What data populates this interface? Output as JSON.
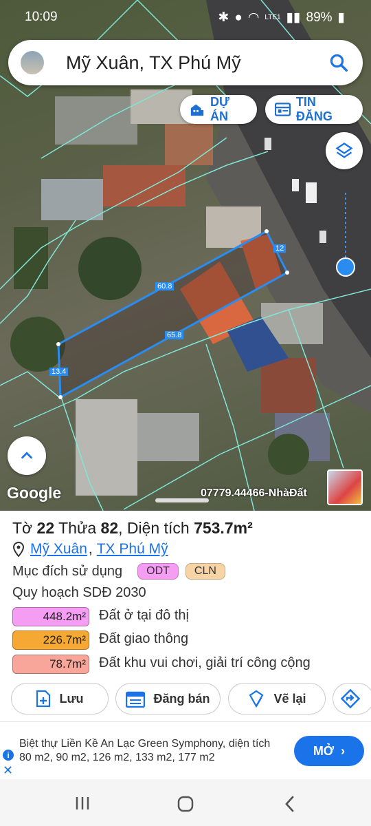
{
  "status": {
    "time": "10:09",
    "battery": "89%",
    "network": "LTE1"
  },
  "search": {
    "title": "Mỹ Xuân, TX Phú Mỹ"
  },
  "top_pills": {
    "du_an": "DỰ ÁN",
    "tin_dang": "TIN ĐĂNG"
  },
  "map": {
    "measurements": {
      "top_edge": "60.8",
      "right_edge": "12",
      "bottom_edge": "65.8",
      "left_edge": "13.4"
    },
    "brand": "Google",
    "watermark": "07779.44466-NhàĐất"
  },
  "parcel": {
    "to_label": "Tờ",
    "to_number": "22",
    "thua_label": "Thửa",
    "thua_number": "82",
    "area_label": ", Diện tích",
    "area_value": "753.7m²",
    "location_commune": "Mỹ Xuân",
    "location_separator": ",",
    "location_town": "TX Phú Mỹ",
    "purpose_label": "Mục đích sử dụng",
    "purpose_tags": [
      {
        "code": "ODT",
        "color": "#f59cf3"
      },
      {
        "code": "CLN",
        "color": "#f7d4a6"
      }
    ],
    "planning_title": "Quy hoạch SDĐ 2030",
    "planning": [
      {
        "area": "448.2m²",
        "label": "Đất ở tại đô thị",
        "color": "#f59cf3"
      },
      {
        "area": "226.7m²",
        "label": "Đất giao thông",
        "color": "#f5a834"
      },
      {
        "area": "78.7m²",
        "label": "Đất khu vui chơi, giải trí công cộng",
        "color": "#f9a69a"
      }
    ]
  },
  "actions": {
    "save": "Lưu",
    "sell": "Đăng bán",
    "redraw": "Vẽ lại"
  },
  "ad": {
    "text": "Biệt thự Liền Kề An Lạc Green Symphony, diện tích 80 m2, 90 m2, 126 m2, 133 m2, 177 m2",
    "open": "MỞ"
  },
  "colors": {
    "accent": "#1a73e8",
    "parcel_outline": "#2b8cf0",
    "boundary_lines": "#7fe6d8"
  }
}
